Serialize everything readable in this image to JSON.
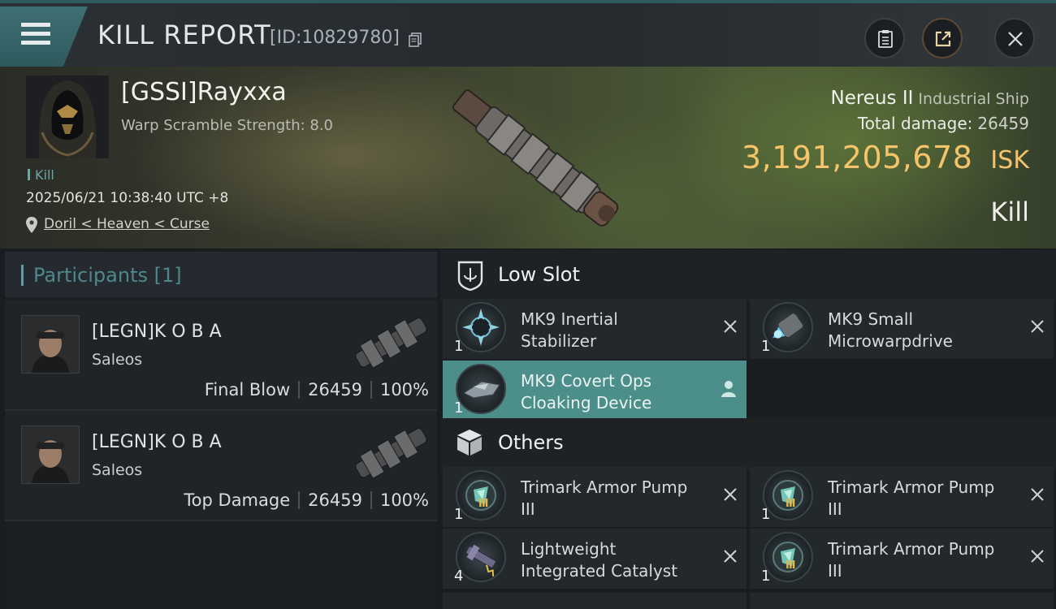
{
  "header": {
    "title": "KILL REPORT",
    "kill_id": "[ID:10829780]"
  },
  "victim": {
    "name": "[GSSI]Rayxxa",
    "warp_scramble": "Warp Scramble Strength: 8.0",
    "tag": "Kill",
    "datetime": "2025/06/21 10:38:40 UTC +8",
    "location": "Doril < Heaven < Curse",
    "ship_name": "Nereus II",
    "ship_class": "Industrial Ship",
    "total_damage_label": "Total damage:",
    "total_damage": "26459",
    "isk_value": "3,191,205,678",
    "isk_unit": "ISK",
    "result": "Kill"
  },
  "participants": {
    "title": "Participants",
    "count": "[1]",
    "rows": [
      {
        "name": "[LEGN]K O B A",
        "ship": "Saleos",
        "role": "Final Blow",
        "damage": "26459",
        "percent": "100%"
      },
      {
        "name": "[LEGN]K O B A",
        "ship": "Saleos",
        "role": "Top Damage",
        "damage": "26459",
        "percent": "100%"
      }
    ]
  },
  "low_slot": {
    "title": "Low Slot",
    "items": [
      {
        "name_line1": "MK9 Inertial",
        "name_line2": "Stabilizer",
        "qty": "1",
        "icon": "inertial-stabilizer-icon"
      },
      {
        "name_line1": "MK9 Small",
        "name_line2": "Microwarpdrive",
        "qty": "1",
        "icon": "microwarpdrive-icon"
      },
      {
        "name_line1": "MK9 Covert Ops",
        "name_line2": "Cloaking Device",
        "qty": "1",
        "icon": "cloaking-device-icon",
        "state": "survived"
      }
    ]
  },
  "others": {
    "title": "Others",
    "items": [
      {
        "name_line1": "Trimark Armor Pump",
        "name_line2": "III",
        "qty": "1",
        "tier": "III",
        "icon": "armor-pump-icon"
      },
      {
        "name_line1": "Trimark Armor Pump",
        "name_line2": "III",
        "qty": "1",
        "tier": "III",
        "icon": "armor-pump-icon"
      },
      {
        "name_line1": "Lightweight",
        "name_line2": "Integrated Catalyst",
        "qty": "4",
        "icon": "catalyst-icon"
      },
      {
        "name_line1": "Trimark Armor Pump",
        "name_line2": "III",
        "qty": "1",
        "tier": "III",
        "icon": "armor-pump-icon"
      }
    ]
  },
  "colors": {
    "accent": "#4c8f8a",
    "isk": "#f5c46a",
    "header_tab": "#3e6f73"
  }
}
